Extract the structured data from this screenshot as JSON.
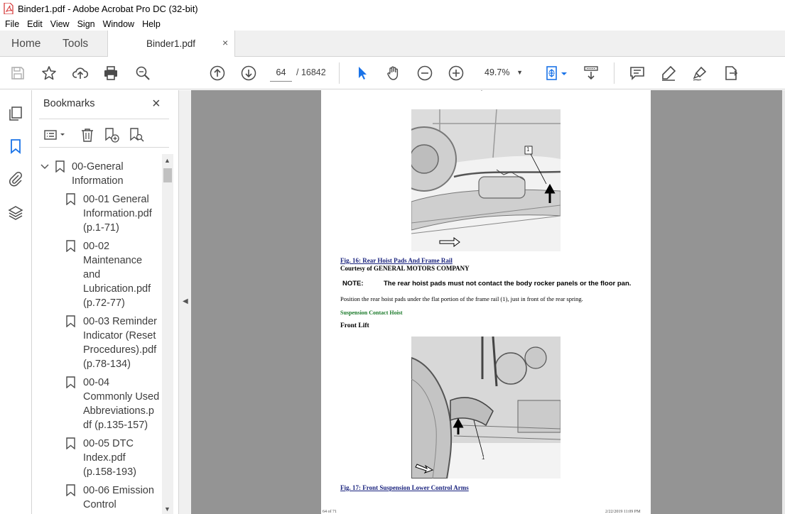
{
  "window": {
    "title": "Binder1.pdf - Adobe Acrobat Pro DC (32-bit)"
  },
  "menu": [
    "File",
    "Edit",
    "View",
    "Sign",
    "Window",
    "Help"
  ],
  "tabs": {
    "home": "Home",
    "tools": "Tools",
    "document": "Binder1.pdf",
    "close": "×"
  },
  "toolbar": {
    "current_page": "64",
    "total_pages": "/  16842",
    "zoom": "49.7%"
  },
  "bookmarks": {
    "title": "Bookmarks",
    "close": "×",
    "items": [
      {
        "lines": [
          "00-General",
          "Information"
        ]
      },
      {
        "lines": [
          "00-01 General",
          "Information.pdf",
          "(p.1-71)"
        ]
      },
      {
        "lines": [
          "00-02",
          "Maintenance",
          "and",
          "Lubrication.pdf",
          "(p.72-77)"
        ]
      },
      {
        "lines": [
          "00-03 Reminder",
          "Indicator (Reset",
          "Procedures).pdf",
          "(p.78-134)"
        ]
      },
      {
        "lines": [
          "00-04",
          "Commonly Used",
          "Abbreviations.p",
          "df (p.135-157)"
        ]
      },
      {
        "lines": [
          "00-05 DTC",
          "Index.pdf",
          "(p.158-193)"
        ]
      },
      {
        "lines": [
          "00-06 Emission",
          "Control"
        ]
      }
    ]
  },
  "document": {
    "top_dash": "-",
    "fig16_callout": "1",
    "fig16_caption": "Fig. 16: Rear Hoist Pads And Frame Rail",
    "fig16_courtesy": "Courtesy of GENERAL MOTORS COMPANY",
    "note_label": "NOTE:",
    "note_text": "The rear hoist pads must not contact the body rocker panels or the floor pan.",
    "body_text": "Position the rear hoist pads under the flat portion of the frame rail (1), just in front of the rear spring.",
    "green_heading": "Suspension Contact Hoist",
    "subheading": "Front Lift",
    "fig17_callout": "1",
    "fig17_caption": "Fig. 17: Front Suspension Lower Control Arms",
    "footer_left": "64 of 71",
    "footer_right": "2/22/2019  11:09 PM"
  }
}
